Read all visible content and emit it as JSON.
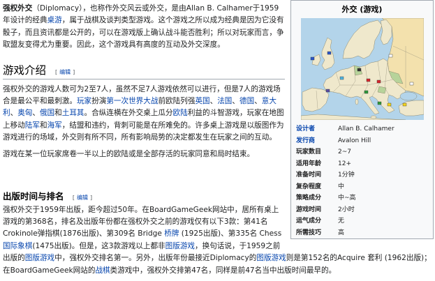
{
  "colors": {
    "link": "#0645ad",
    "text": "#202122",
    "infobox_bg": "#f8f9fa",
    "infobox_border": "#a2a9b1"
  },
  "ui": {
    "edit_open": "[",
    "edit_label": "编辑",
    "edit_close": "]"
  },
  "intro": [
    {
      "t": "强权外交",
      "bold": true
    },
    {
      "t": "（Diplomacy），也称作外交风云或外交，是由Allan B. Calhamer于1959年设计的经典"
    },
    {
      "t": "桌游",
      "link": true
    },
    {
      "t": "，属于战棋及谈判类型游戏。这个游戏之所以成为经典是因为它没有骰子，而且资讯都是公开的，可以在游戏版上确认战斗能否胜利；所以对玩家而言，争取盟友变得尤为重要。因此，这个游戏具有高度的互动及外交深度。"
    }
  ],
  "sections": [
    {
      "heading": "游戏介绍",
      "paragraphs": [
        [
          {
            "t": "强权外交的游戏人数可为2至7人，虽然不足7人游戏依然可以进行，但是7人的游戏场合是最公平和最刺激。"
          },
          {
            "t": "玩家",
            "link": true
          },
          {
            "t": "扮演"
          },
          {
            "t": "第一次世界大战",
            "link": true
          },
          {
            "t": "前欧陆列强"
          },
          {
            "t": "英国",
            "link": true
          },
          {
            "t": "、"
          },
          {
            "t": "法国",
            "link": true
          },
          {
            "t": "、"
          },
          {
            "t": "德国",
            "link": true
          },
          {
            "t": "、"
          },
          {
            "t": "意大利",
            "link": true
          },
          {
            "t": "、"
          },
          {
            "t": "奥匈",
            "link": true
          },
          {
            "t": "、"
          },
          {
            "t": "俄国",
            "link": true
          },
          {
            "t": "和"
          },
          {
            "t": "土耳其",
            "link": true
          },
          {
            "t": "。合纵连横在外交桌上瓜分"
          },
          {
            "t": "欧陆",
            "link": true
          },
          {
            "t": "利益的斗智游戏，玩家在地图上移动"
          },
          {
            "t": "陆军",
            "link": true
          },
          {
            "t": "和"
          },
          {
            "t": "海军",
            "link": true
          },
          {
            "t": "，结盟和违约，背刺可能是在所难免的。许多桌上游戏是以版图作为游戏进行的场域，外交则有所不同，所有影响局势的决定都发生在玩家之间的互动。"
          }
        ],
        [
          {
            "t": "游戏在某一位玩家席卷一半以上的欧陆或是全部存活的玩家同意和局时结束。"
          }
        ]
      ]
    },
    {
      "heading": "出版时间与排名",
      "paragraphs": [
        [
          {
            "t": "强权外交于1959年出版，距今超过50年。在BoardGameGeek网站中，居所有桌上游戏的第368名，排名及出版年份都在强权外交之前的游戏仅有以下3款：第41名Crokinole弹指棋(1876出版)、第309名 Bridge "
          },
          {
            "t": "桥牌",
            "link": true
          },
          {
            "t": " (1925出版)、第335名 Chess "
          },
          {
            "t": "国际象棋",
            "link": true
          },
          {
            "t": "(1475出版)。但是，这3款游戏以上都非"
          },
          {
            "t": "图版游戏",
            "link": true
          },
          {
            "t": "，换句话说，于1959之前出版的"
          },
          {
            "t": "图版游戏",
            "link": true
          },
          {
            "t": "中，强权外交排名第一。另外，出版年份最接近Diplomacy的"
          },
          {
            "t": "图版游戏",
            "link": true
          },
          {
            "t": "则是第152名的Acquire 套利 (1962出版)；在BoardGameGeek网站的"
          },
          {
            "t": "战棋",
            "link": true
          },
          {
            "t": "类游戏中，强权外交排第47名，同样是前47名当中出版时间最早的。"
          }
        ]
      ]
    }
  ],
  "infobox": {
    "title": "外交 (游戏)",
    "rows": [
      {
        "label": "设计者",
        "value": "Allan B. Calhamer"
      },
      {
        "label": "发行商",
        "value": "Avalon Hill"
      },
      {
        "label": "玩家数目",
        "value": "2~7"
      },
      {
        "label": "适用年龄",
        "value": "12+"
      },
      {
        "label": "准备时间",
        "value": "1分钟"
      },
      {
        "label": "复杂程度",
        "value": "中"
      },
      {
        "label": "策略成分",
        "value": "中~高"
      },
      {
        "label": "游戏时间",
        "value": "2小时"
      },
      {
        "label": "运气成分",
        "value": "无"
      },
      {
        "label": "所需技巧",
        "value": "高"
      }
    ]
  }
}
